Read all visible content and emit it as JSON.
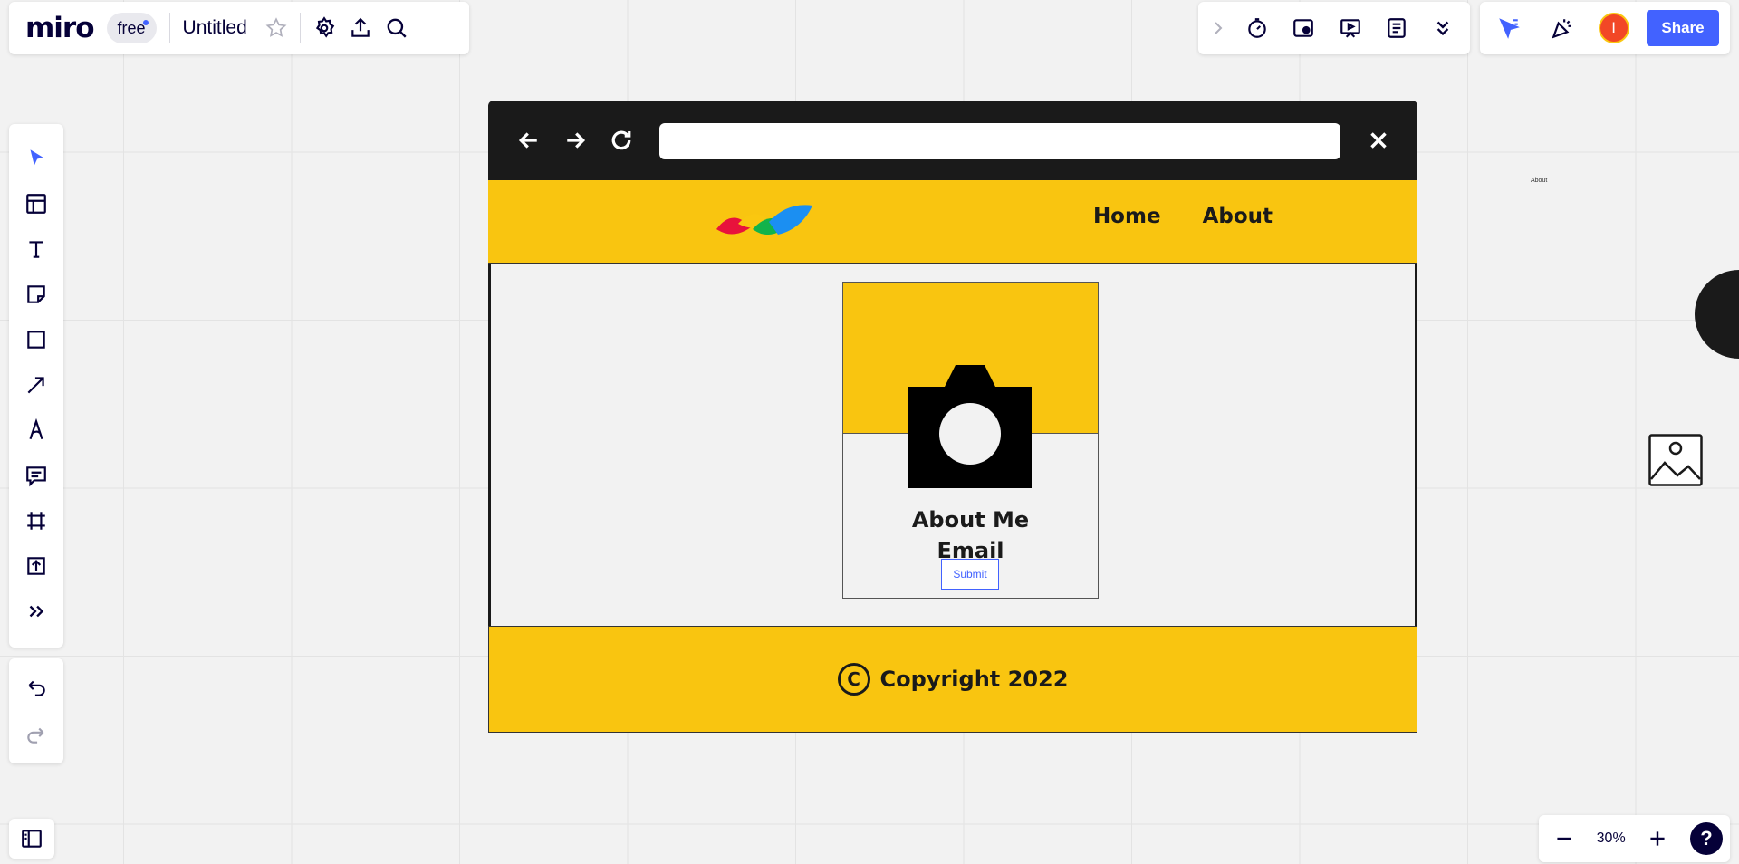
{
  "app": {
    "logo": "miro",
    "plan": "free",
    "board_title": "Untitled"
  },
  "topbar_collab": {
    "avatar_initial": "I",
    "share_label": "Share"
  },
  "left_toolbar": {
    "items": [
      "select",
      "templates",
      "text",
      "sticky-note",
      "shapes",
      "connection-line",
      "pen",
      "comment",
      "frame",
      "upload",
      "more-tools"
    ]
  },
  "zoom": {
    "value": "30%"
  },
  "help": {
    "label": "?"
  },
  "wireframe": {
    "nav": {
      "home": "Home",
      "about": "About"
    },
    "card": {
      "title": "About Me",
      "subtitle": "Email",
      "button": "Submit"
    },
    "footer": {
      "symbol": "C",
      "text": "Copyright 2022"
    },
    "colors": {
      "brand_yellow": "#f9c510",
      "chrome": "#1a1a1a"
    }
  },
  "canvas": {
    "tiny_label": "About"
  },
  "colors": {
    "accent": "#4262ff",
    "avatar": "#f24726"
  }
}
